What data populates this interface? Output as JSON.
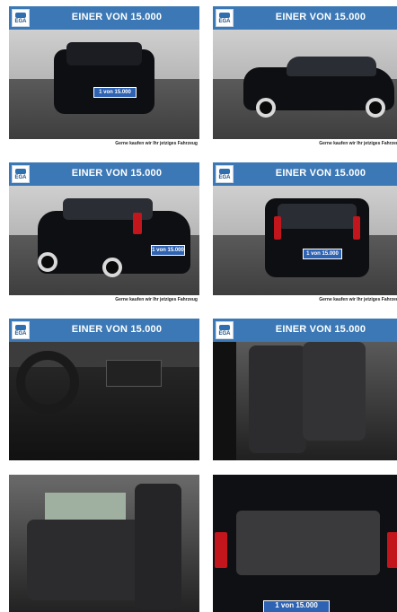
{
  "banner": {
    "logo_text": "EGA",
    "headline": "EINER VON 15.000"
  },
  "footer_text": "Gerne kaufen wir Ihr jetziges Fahrzeug",
  "plate_text": "1 von 15.000",
  "tiles": [
    {
      "label": "front view"
    },
    {
      "label": "side view"
    },
    {
      "label": "rear three-quarter view"
    },
    {
      "label": "rear view"
    },
    {
      "label": "dashboard interior"
    },
    {
      "label": "front seats interior"
    },
    {
      "label": "rear seats interior"
    },
    {
      "label": "trunk view"
    }
  ],
  "colors": {
    "banner": "#3b78b5",
    "car": "#0e0f12",
    "plate": "#2e62b2"
  }
}
